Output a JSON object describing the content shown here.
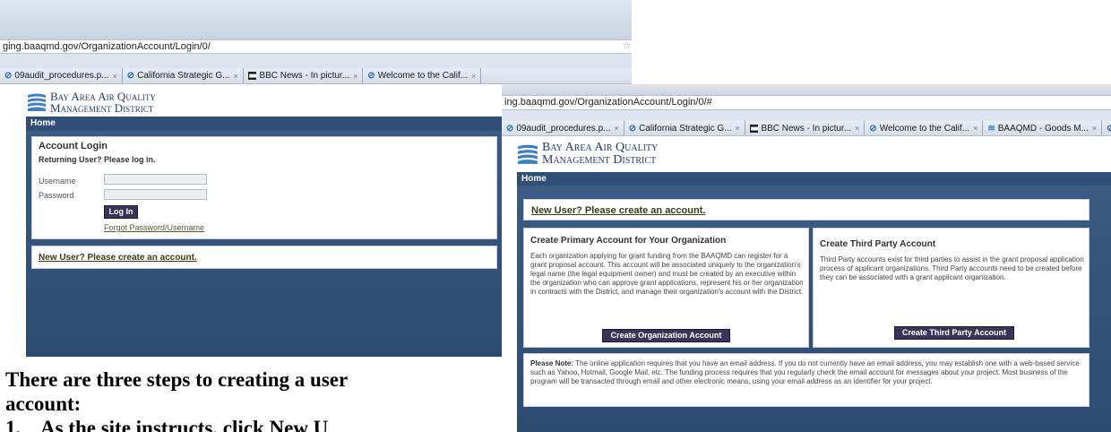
{
  "left_shot": {
    "url": "ging.baaqmd.gov/OrganizationAccount/Login/0/",
    "tabs": [
      {
        "icon": "globe-icon",
        "label": "09audit_procedures.p..."
      },
      {
        "icon": "globe-icon",
        "label": "California Strategic G..."
      },
      {
        "icon": "bbc-icon",
        "label": "BBC News - In pictur..."
      },
      {
        "icon": "globe-icon",
        "label": "Welcome to the Calif..."
      }
    ],
    "logo": {
      "line1": "Bay Area Air Quality",
      "line2": "Management District"
    },
    "nav_home": "Home",
    "login": {
      "title": "Account Login",
      "subtitle": "Returning User? Please log in.",
      "username_label": "Username",
      "password_label": "Password",
      "login_button": "Log In",
      "forgot_link": "Forgot Password/Username"
    },
    "new_user_link": "New User? Please create an account."
  },
  "right_shot": {
    "url": "ing.baaqmd.gov/OrganizationAccount/Login/0/#",
    "tabs": [
      {
        "icon": "globe-icon",
        "label": "09audit_procedures.p..."
      },
      {
        "icon": "globe-icon",
        "label": "California Strategic G..."
      },
      {
        "icon": "bbc-icon",
        "label": "BBC News - In pictur..."
      },
      {
        "icon": "globe-icon",
        "label": "Welcome to the Calif..."
      },
      {
        "icon": "baaqmd-icon",
        "label": "BAAQMD - Goods M..."
      }
    ],
    "logo": {
      "line1": "Bay Area Air Quality",
      "line2": "Management District"
    },
    "nav_home": "Home",
    "new_user_link": "New User? Please create an account.",
    "primary": {
      "title": "Create Primary Account for Your Organization",
      "body": "Each organization applying for grant funding from the BAAQMD can register for a grant proposal account. This account will be associated uniquely to the organization's legal name (the legal equipment owner) and must be created by an executive within the organization who can approve grant applications, represent his or her organization in contracts with the District, and manage their organization's account with the District.",
      "button": "Create Organization Account"
    },
    "third_party": {
      "title": "Create Third Party Account",
      "body": "Third Party accounts exist for third parties to assist in the grant proposal application process of applicant organizations. Third Party accounts need to be created before they can be associated with a grant applicant organization.",
      "button": "Create Third Party Account"
    },
    "note": {
      "label": "Please Note:",
      "text": " The online application requires that you have an email address. If you do not currently have an email address, you may establish one with a web-based service such as Yahoo, Hotmail, Google Mail, etc. The funding process requires that you regularly check the email account for messages about your project. Most business of the program will be transacted through email and other electronic means, using your email address as an identifier for your project."
    }
  },
  "caption": {
    "line1": "There are three steps to creating a user",
    "line2": "account:",
    "line3": "1.    As the site instructs, click New U"
  }
}
